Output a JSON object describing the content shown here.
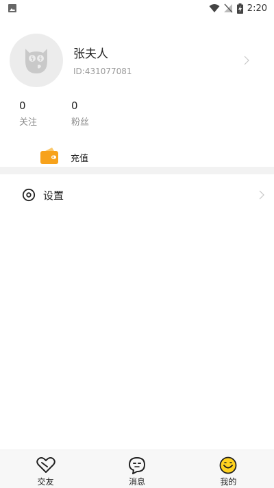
{
  "status_bar": {
    "time": "2:20"
  },
  "profile": {
    "username": "张夫人",
    "user_id": "ID:431077081"
  },
  "stats": {
    "following": {
      "count": "0",
      "label": "关注"
    },
    "fans": {
      "count": "0",
      "label": "粉丝"
    }
  },
  "recharge": {
    "label": "充值",
    "icon": "wallet-icon",
    "color": "#f7a21b"
  },
  "settings": {
    "label": "设置",
    "icon": "settings-icon"
  },
  "nav": {
    "items": [
      {
        "label": "交友",
        "icon": "heart-icon"
      },
      {
        "label": "消息",
        "icon": "chat-face-icon"
      },
      {
        "label": "我的",
        "icon": "smiley-icon",
        "active": true,
        "active_color": "#ffd21f"
      }
    ]
  }
}
